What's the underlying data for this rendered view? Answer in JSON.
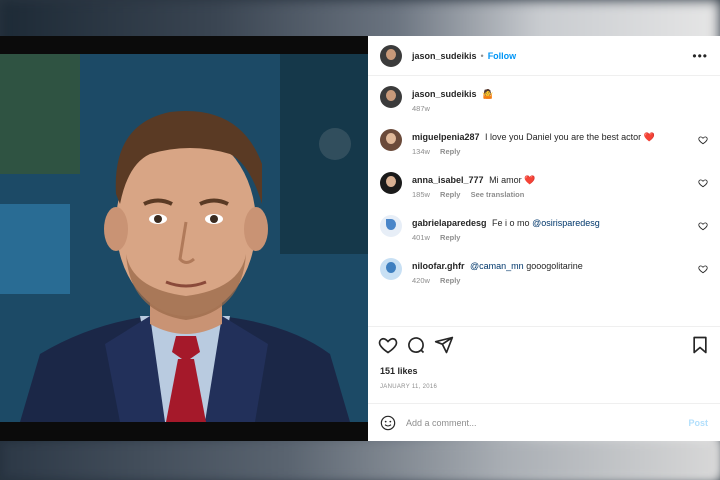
{
  "post": {
    "username": "jason_sudeikis",
    "separator": "•",
    "follow_label": "Follow",
    "more_label": "•••"
  },
  "caption": {
    "username": "jason_sudeikis",
    "text": "🤷",
    "age": "487w"
  },
  "comments": [
    {
      "username": "miguelpenia287",
      "text": "I love you Daniel you are the best actor",
      "emoji": "❤️",
      "age": "134w",
      "reply": "Reply",
      "translate": ""
    },
    {
      "username": "anna_isabel_777",
      "text": "Mi amor",
      "emoji": "❤️",
      "age": "185w",
      "reply": "Reply",
      "translate": "See translation"
    },
    {
      "username": "gabrielaparedesg",
      "text": "Fe i o mo",
      "mention": "@osirisparedesg",
      "age": "401w",
      "reply": "Reply"
    },
    {
      "username": "niloofar.ghfr",
      "text": "",
      "mention": "@caman_mn",
      "text_after": "gooogolitarine",
      "age": "420w",
      "reply": "Reply"
    }
  ],
  "likes": "151 likes",
  "date": "JANUARY 11, 2016",
  "add_comment": {
    "placeholder": "Add a comment...",
    "post_label": "Post"
  },
  "icons": {
    "like": "heart-icon",
    "comment": "comment-icon",
    "share": "share-icon",
    "save": "bookmark-icon",
    "emoji": "emoji-icon"
  },
  "colors": {
    "follow": "#0095f6",
    "heart": "#ed4956",
    "post_disabled": "#b2dffc"
  }
}
